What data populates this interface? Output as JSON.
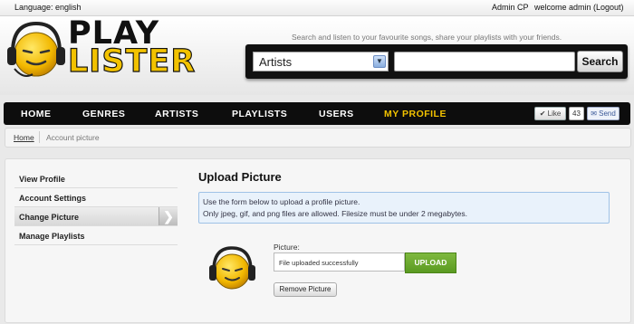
{
  "topbar": {
    "language": "Language: english",
    "admin_link": "Admin CP",
    "welcome": "welcome admin (Logout)"
  },
  "logo": {
    "line1": "PLAY",
    "line2": "LISTER"
  },
  "search": {
    "tagline": "Search and listen to your favourite songs, share your playlists with your friends.",
    "category_selected": "Artists",
    "query": "",
    "button_label": "Search"
  },
  "nav": {
    "items": [
      {
        "label": "HOME"
      },
      {
        "label": "GENRES"
      },
      {
        "label": "ARTISTS"
      },
      {
        "label": "PLAYLISTS"
      },
      {
        "label": "USERS"
      },
      {
        "label": "MY PROFILE"
      }
    ]
  },
  "social": {
    "like_label": "Like",
    "like_count": "43",
    "send_label": "Send"
  },
  "breadcrumb": {
    "home": "Home",
    "current": "Account picture"
  },
  "sidebar": {
    "items": [
      {
        "label": "View Profile"
      },
      {
        "label": "Account Settings"
      },
      {
        "label": "Change Picture"
      },
      {
        "label": "Manage Playlists"
      }
    ]
  },
  "content": {
    "title": "Upload Picture",
    "info_line1": "Use the form below to upload a profile picture.",
    "info_line2": "Only jpeg, gif, and png files are allowed. Filesize must be under 2 megabytes.",
    "picture_label": "Picture:",
    "file_status": "File uploaded successfully",
    "upload_label": "UPLOAD",
    "remove_label": "Remove Picture"
  },
  "colors": {
    "accent": "#f2c200",
    "nav_bg": "#0d0d0d",
    "upload_green": "#6aa82e",
    "info_bg": "#e9f2fb"
  }
}
